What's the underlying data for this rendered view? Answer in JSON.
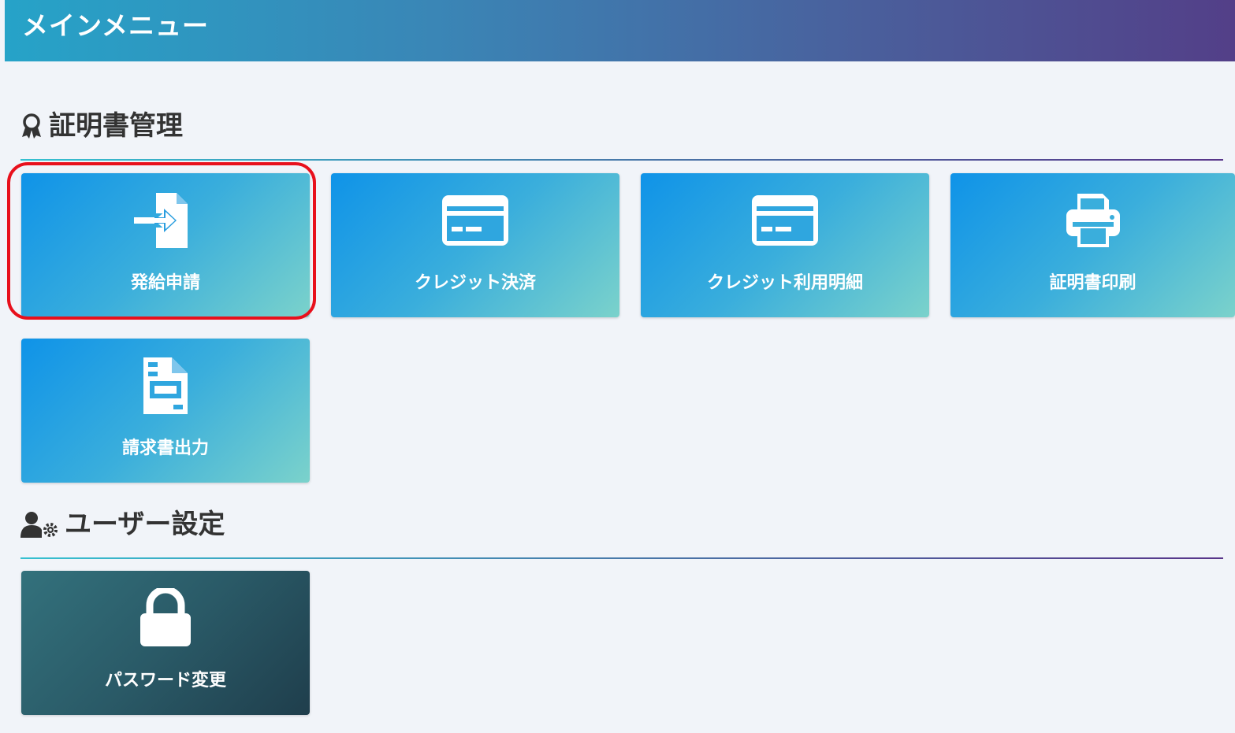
{
  "header": {
    "title": "メインメニュー"
  },
  "sections": [
    {
      "title": "証明書管理",
      "icon": "award-icon",
      "tiles": [
        {
          "label": "発給申請",
          "icon": "file-import-icon",
          "highlighted": true
        },
        {
          "label": "クレジット決済",
          "icon": "credit-card-icon"
        },
        {
          "label": "クレジット利用明細",
          "icon": "credit-card-icon"
        },
        {
          "label": "証明書印刷",
          "icon": "printer-icon"
        },
        {
          "label": "請求書出力",
          "icon": "file-invoice-icon"
        }
      ]
    },
    {
      "title": "ユーザー設定",
      "icon": "user-cog-icon",
      "tiles": [
        {
          "label": "パスワード変更",
          "icon": "lock-icon"
        }
      ]
    }
  ],
  "colors": {
    "header_gradient": [
      "#26a3c8",
      "#533f88"
    ],
    "tile_gradient": [
      "#0f93e8",
      "#7bd2cb"
    ],
    "dark_tile_gradient": [
      "#33717c",
      "#1f3e4c"
    ],
    "highlight": "#e8101c",
    "section_text": "#333333",
    "background": "#f1f4f9"
  }
}
